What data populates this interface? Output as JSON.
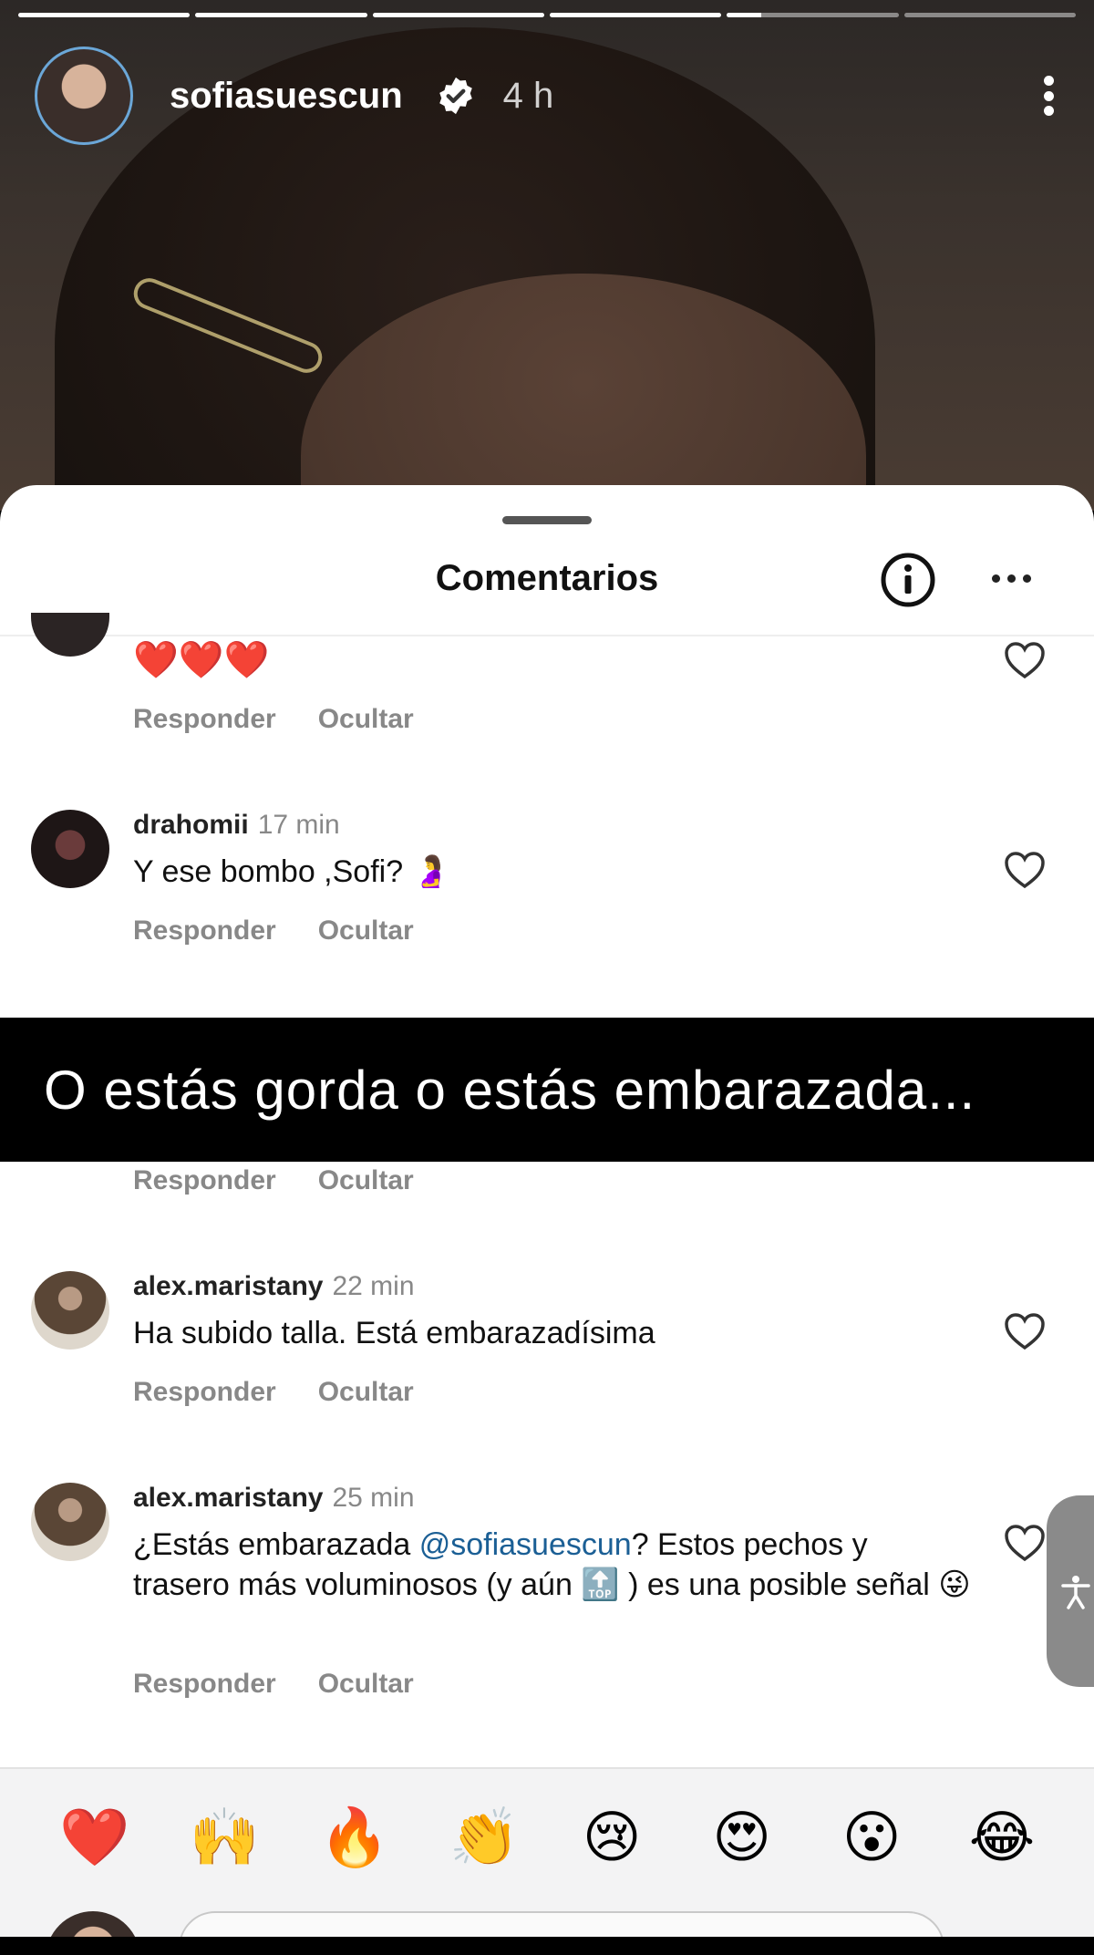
{
  "story": {
    "username": "sofiasuescun",
    "time_ago": "4 h",
    "progress": [
      1,
      1,
      1,
      1,
      0.2,
      0
    ]
  },
  "sheet": {
    "title": "Comentarios"
  },
  "comments": [
    {
      "username": "",
      "time": "",
      "text": "❤️❤️❤️",
      "reply": "Responder",
      "hide": "Ocultar"
    },
    {
      "username": "drahomii",
      "time": "17 min",
      "text": "Y ese bombo ,Sofi? 🤰",
      "reply": "Responder",
      "hide": "Ocultar"
    },
    {
      "username": "",
      "time": "",
      "text": "",
      "reply": "Responder",
      "hide": "Ocultar"
    },
    {
      "username": "alex.maristany",
      "time": "22 min",
      "text": "Ha subido talla. Está embarazadísima",
      "reply": "Responder",
      "hide": "Ocultar"
    },
    {
      "username": "alex.maristany",
      "time": "25 min",
      "text_before": "¿Estás embarazada ",
      "mention": "@sofiasuescun",
      "text_after": "? Estos pechos y trasero más voluminosos (y aún 🔝 ) es una posible señal 😜",
      "reply": "Responder",
      "hide": "Ocultar"
    }
  ],
  "caption": "O estás gorda o estás embarazada...",
  "reactions": [
    "❤️",
    "🙌",
    "🔥",
    "👏",
    "😢",
    "😍",
    "😮",
    "😂"
  ],
  "colors": {
    "verified": "#ffffff",
    "mention": "#1b5f95",
    "sheet_bg": "#ffffff"
  }
}
